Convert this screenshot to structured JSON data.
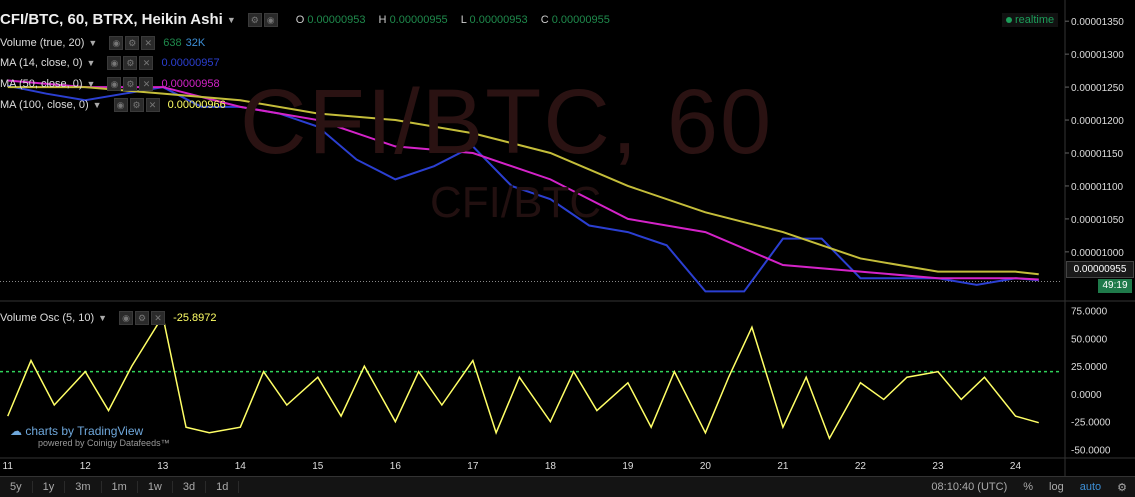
{
  "header": {
    "symbol": "CFI/BTC, 60, BTRX, Heikin Ashi",
    "o_label": "O",
    "o_val": "0.00000953",
    "h_label": "H",
    "h_val": "0.00000955",
    "l_label": "L",
    "l_val": "0.00000953",
    "c_label": "C",
    "c_val": "0.00000955",
    "realtime": "realtime"
  },
  "indicators": {
    "volume": {
      "label": "Volume (true, 20)",
      "v1": "638",
      "v2": "32K"
    },
    "ma14": {
      "label": "MA (14, close, 0)",
      "value": "0.00000957"
    },
    "ma50": {
      "label": "MA (50, close, 0)",
      "value": "0.00000958"
    },
    "ma100": {
      "label": "MA (100, close, 0)",
      "value": "0.00000966"
    },
    "osc": {
      "label": "Volume Osc (5, 10)",
      "value": "-25.8972"
    }
  },
  "watermark": {
    "big": "CFI/BTC, 60",
    "small": "CFI/BTC"
  },
  "current_price": "0.00000955",
  "timer": "49:19",
  "attribution": {
    "main": "charts by TradingView",
    "sub": "powered by Coinigy Datafeeds™"
  },
  "timeframes": [
    "5y",
    "1y",
    "3m",
    "1m",
    "1w",
    "3d",
    "1d"
  ],
  "status": {
    "time": "08:10:40 (UTC)",
    "percent": "%",
    "log": "log",
    "auto": "auto"
  },
  "colors": {
    "up": "#1f8a4c",
    "down": "#c0392b",
    "ma14": "#2b3fd1",
    "ma50": "#d423c8",
    "ma100": "#c4bd3a",
    "osc": "#ffff66",
    "zero_line": "#2fd35a"
  },
  "chart_data": [
    {
      "type": "line",
      "title": "CFI/BTC, 60, BTRX, Heikin Ashi",
      "x_ticks": [
        "11",
        "12",
        "13",
        "14",
        "15",
        "16",
        "17",
        "18",
        "19",
        "20",
        "21",
        "22",
        "23",
        "24"
      ],
      "y_ticks": [
        "0.00001350",
        "0.00001300",
        "0.00001250",
        "0.00001200",
        "0.00001150",
        "0.00001100",
        "0.00001050",
        "0.00001000"
      ],
      "ylim": [
        9.3e-06,
        1.37e-05
      ],
      "series": [
        {
          "name": "MA (14, close, 0)",
          "x": [
            11,
            11.5,
            12,
            12.5,
            13,
            13.5,
            14,
            14.5,
            15,
            15.5,
            16,
            16.5,
            17,
            17.5,
            18,
            18.5,
            19,
            19.5,
            20,
            20.5,
            21,
            21.5,
            22,
            22.5,
            23,
            23.5,
            24,
            24.3
          ],
          "values": [
            1.252e-05,
            1.24e-05,
            1.23e-05,
            1.24e-05,
            1.25e-05,
            1.22e-05,
            1.22e-05,
            1.21e-05,
            1.19e-05,
            1.14e-05,
            1.11e-05,
            1.13e-05,
            1.16e-05,
            1.1e-05,
            1.08e-05,
            1.04e-05,
            1.03e-05,
            1.01e-05,
            9.4e-06,
            9.4e-06,
            1.02e-05,
            1.02e-05,
            9.6e-06,
            9.6e-06,
            9.6e-06,
            9.5e-06,
            9.6e-06,
            9.57e-06
          ]
        },
        {
          "name": "MA (50, close, 0)",
          "x": [
            11,
            12,
            13,
            14,
            15,
            16,
            17,
            18,
            19,
            20,
            21,
            22,
            23,
            24,
            24.3
          ],
          "values": [
            1.26e-05,
            1.25e-05,
            1.25e-05,
            1.22e-05,
            1.2e-05,
            1.16e-05,
            1.15e-05,
            1.11e-05,
            1.05e-05,
            1.03e-05,
            9.8e-06,
            9.7e-06,
            9.6e-06,
            9.6e-06,
            9.58e-06
          ]
        },
        {
          "name": "MA (100, close, 0)",
          "x": [
            11,
            12,
            13,
            14,
            15,
            16,
            17,
            18,
            19,
            20,
            21,
            22,
            23,
            24,
            24.3
          ],
          "values": [
            1.25e-05,
            1.25e-05,
            1.24e-05,
            1.23e-05,
            1.21e-05,
            1.2e-05,
            1.18e-05,
            1.15e-05,
            1.1e-05,
            1.06e-05,
            1.03e-05,
            9.9e-06,
            9.7e-06,
            9.7e-06,
            9.66e-06
          ]
        }
      ]
    },
    {
      "type": "line",
      "title": "Volume Osc (5, 10)",
      "y_ticks": [
        "75.0000",
        "50.0000",
        "25.0000",
        "0.0000",
        "-25.0000",
        "-50.0000"
      ],
      "ylim": [
        -55,
        80
      ],
      "reference_line": 20,
      "series": [
        {
          "name": "Volume Osc (5, 10)",
          "x": [
            11,
            11.3,
            11.6,
            12,
            12.3,
            12.6,
            13,
            13.3,
            13.6,
            14,
            14.3,
            14.6,
            15,
            15.3,
            15.6,
            16,
            16.3,
            16.6,
            17,
            17.3,
            17.6,
            18,
            18.3,
            18.6,
            19,
            19.3,
            19.6,
            20,
            20.3,
            20.6,
            21,
            21.3,
            21.6,
            22,
            22.3,
            22.6,
            23,
            23.3,
            23.6,
            24,
            24.3
          ],
          "values": [
            -20,
            30,
            -10,
            20,
            -15,
            25,
            70,
            -30,
            -35,
            -30,
            20,
            -10,
            15,
            -20,
            25,
            -25,
            20,
            -10,
            30,
            -35,
            15,
            -25,
            20,
            -15,
            10,
            -30,
            20,
            -35,
            15,
            60,
            -30,
            15,
            -40,
            10,
            -5,
            15,
            20,
            -5,
            15,
            -20,
            -25.9
          ]
        }
      ]
    }
  ]
}
